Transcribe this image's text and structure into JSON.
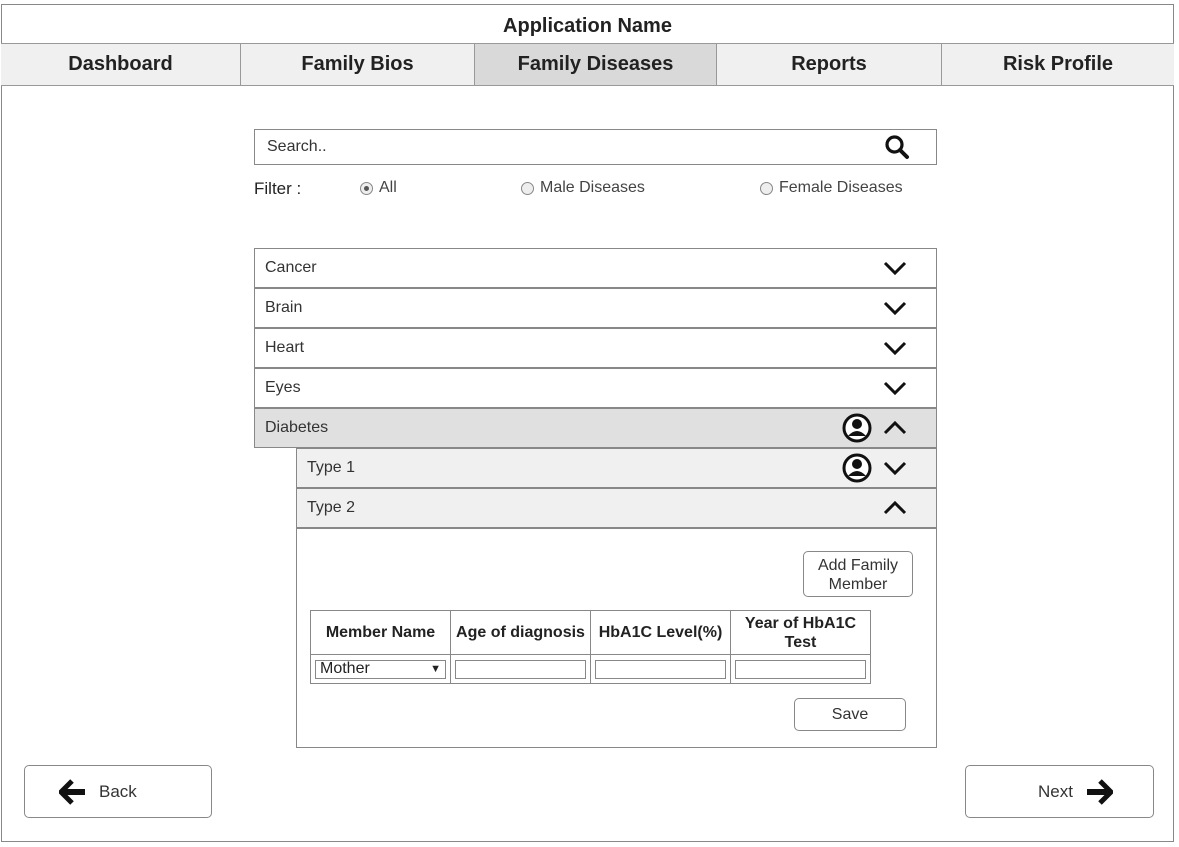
{
  "app": {
    "title": "Application Name"
  },
  "tabs": [
    {
      "label": "Dashboard",
      "active": false
    },
    {
      "label": "Family Bios",
      "active": false
    },
    {
      "label": "Family Diseases",
      "active": true
    },
    {
      "label": "Reports",
      "active": false
    },
    {
      "label": "Risk Profile",
      "active": false
    }
  ],
  "search": {
    "placeholder": "Search..",
    "icon": "search-icon"
  },
  "filter": {
    "label": "Filter :",
    "options": [
      {
        "label": "All",
        "selected": true
      },
      {
        "label": "Male Diseases",
        "selected": false
      },
      {
        "label": "Female Diseases",
        "selected": false
      }
    ]
  },
  "categories": [
    {
      "label": "Cancer",
      "expanded": false
    },
    {
      "label": "Brain",
      "expanded": false
    },
    {
      "label": "Heart",
      "expanded": false
    },
    {
      "label": "Eyes",
      "expanded": false
    },
    {
      "label": "Diabetes",
      "expanded": true,
      "has_member": true
    }
  ],
  "subcategories": [
    {
      "label": "Type 1",
      "expanded": false,
      "has_member": true
    },
    {
      "label": "Type 2",
      "expanded": true,
      "has_member": false
    }
  ],
  "detail": {
    "add_button": "Add Family Member",
    "columns": [
      "Member Name",
      "Age of diagnosis",
      "HbA1C Level(%)",
      "Year of HbA1C Test"
    ],
    "row": {
      "member": "Mother",
      "age": "",
      "hba1c": "",
      "year": ""
    },
    "save_button": "Save"
  },
  "footer": {
    "back_label": "Back",
    "next_label": "Next"
  },
  "colors": {
    "active_tab": "#d9d9d9",
    "tab_bg": "#f0f0f0",
    "expanded_bg": "#e0e0e0",
    "sub_bg": "#f0f0f0"
  }
}
